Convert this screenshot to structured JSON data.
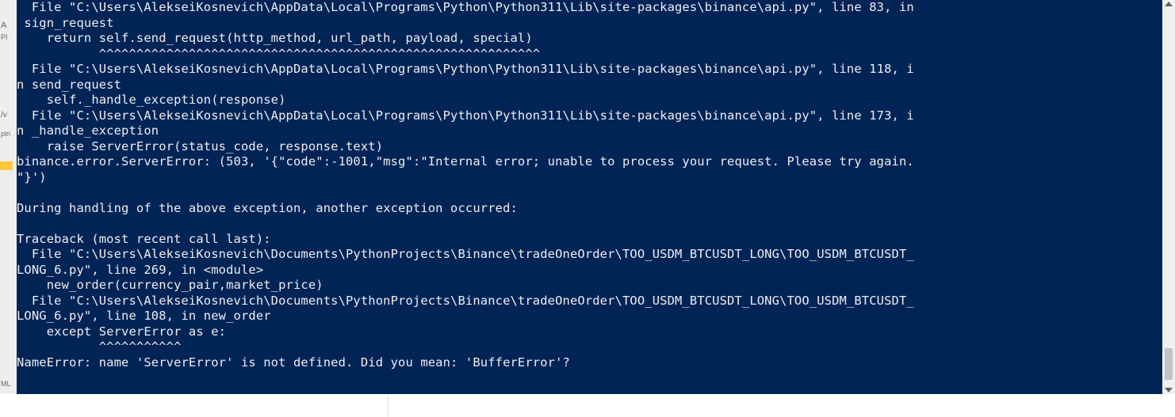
{
  "gutter": {
    "a": "A",
    "pi": "PI",
    "v": "/v",
    "pin": "pin",
    "ml": "ML"
  },
  "terminal": {
    "lines": [
      "  File \"C:\\Users\\AlekseiKosnevich\\AppData\\Local\\Programs\\Python\\Python311\\Lib\\site-packages\\binance\\api.py\", line 83, in",
      " sign_request",
      "    return self.send_request(http_method, url_path, payload, special)",
      "           ^^^^^^^^^^^^^^^^^^^^^^^^^^^^^^^^^^^^^^^^^^^^^^^^^^^^^^^^^^^",
      "  File \"C:\\Users\\AlekseiKosnevich\\AppData\\Local\\Programs\\Python\\Python311\\Lib\\site-packages\\binance\\api.py\", line 118, i",
      "n send_request",
      "    self._handle_exception(response)",
      "  File \"C:\\Users\\AlekseiKosnevich\\AppData\\Local\\Programs\\Python\\Python311\\Lib\\site-packages\\binance\\api.py\", line 173, i",
      "n _handle_exception",
      "    raise ServerError(status_code, response.text)",
      "binance.error.ServerError: (503, '{\"code\":-1001,\"msg\":\"Internal error; unable to process your request. Please try again.",
      "\"}')",
      "",
      "During handling of the above exception, another exception occurred:",
      "",
      "Traceback (most recent call last):",
      "  File \"C:\\Users\\AlekseiKosnevich\\Documents\\PythonProjects\\Binance\\tradeOneOrder\\TOO_USDM_BTCUSDT_LONG\\TOO_USDM_BTCUSDT_",
      "LONG_6.py\", line 269, in <module>",
      "    new_order(currency_pair,market_price)",
      "  File \"C:\\Users\\AlekseiKosnevich\\Documents\\PythonProjects\\Binance\\tradeOneOrder\\TOO_USDM_BTCUSDT_LONG\\TOO_USDM_BTCUSDT_",
      "LONG_6.py\", line 108, in new_order",
      "    except ServerError as e:",
      "           ^^^^^^^^^^^",
      "NameError: name 'ServerError' is not defined. Did you mean: 'BufferError'?"
    ]
  }
}
